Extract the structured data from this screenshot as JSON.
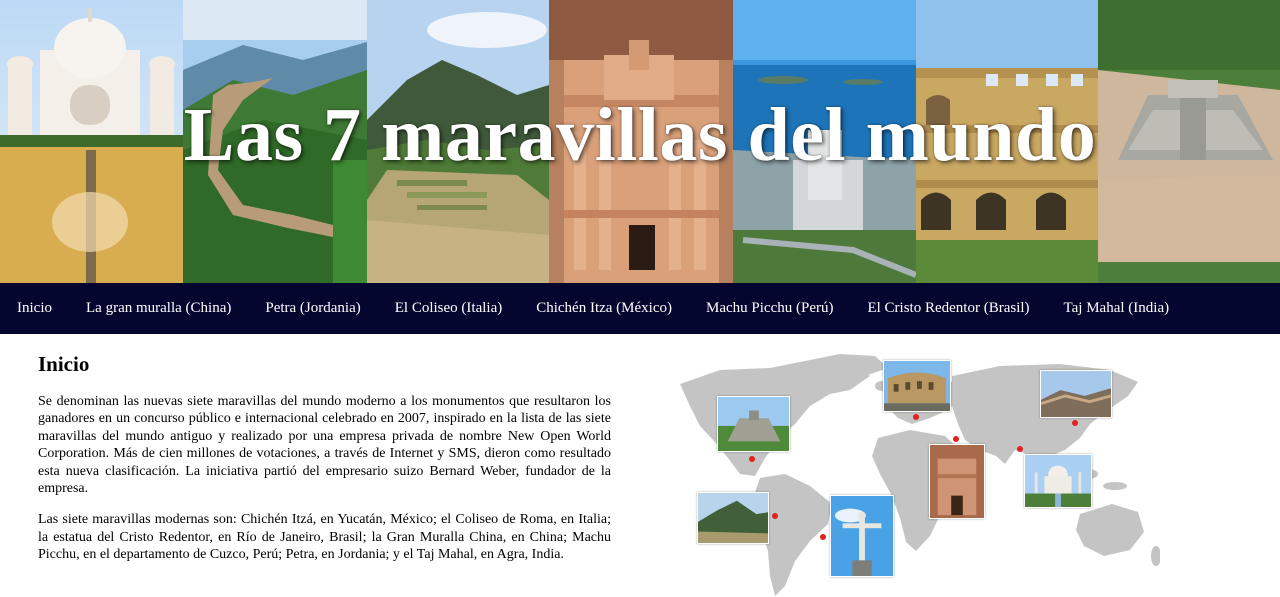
{
  "header": {
    "title": "Las 7 maravillas del mundo",
    "panels": [
      {
        "name": "taj-mahal-photo",
        "sky": "#cfe3f7"
      },
      {
        "name": "great-wall-photo",
        "sky": "#9cc6ec"
      },
      {
        "name": "machu-picchu-photo",
        "sky": "#a8c9ea"
      },
      {
        "name": "petra-photo",
        "sky": "#c99577"
      },
      {
        "name": "cristo-redentor-photo",
        "sky": "#2f8fd9"
      },
      {
        "name": "coliseo-photo",
        "sky": "#8dbbe8"
      },
      {
        "name": "chichen-itza-photo",
        "sky": "#7aa66a"
      }
    ]
  },
  "nav": {
    "items": [
      {
        "label": "Inicio"
      },
      {
        "label": "La gran muralla (China)"
      },
      {
        "label": "Petra (Jordania)"
      },
      {
        "label": "El Coliseo (Italia)"
      },
      {
        "label": "Chichén Itza (México)"
      },
      {
        "label": "Machu Picchu (Perú)"
      },
      {
        "label": "El Cristo Redentor (Brasil)"
      },
      {
        "label": "Taj Mahal (India)"
      }
    ]
  },
  "main": {
    "heading": "Inicio",
    "paragraphs": [
      "Se denominan las nuevas siete maravillas del mundo moderno a los monumentos que resultaron los ganadores en un concurso público e internacional celebrado en 2007, inspirado en la lista de las siete maravillas del mundo antiguo y realizado por una empresa privada de nombre New Open World Corporation. Más de cien millones de votaciones, a través de Internet y SMS, dieron como resultado esta nueva clasificación. La iniciativa partió del empresario suizo Bernard Weber, fundador de la empresa.",
      "Las siete maravillas modernas son: Chichén Itzá, en Yucatán, México; el Coliseo de Roma, en Italia; la estatua del Cristo Redentor, en Río de Janeiro, Brasil; la Gran Muralla China, en China; Machu Picchu, en el departamento de Cuzco, Perú; Petra, en Jordania; y el Taj Mahal, en Agra, India."
    ]
  },
  "map": {
    "land_color": "#c4c4c4",
    "marker_color": "#e2231a",
    "thumbnails": [
      "chichen-itza-thumb",
      "coliseo-thumb",
      "great-wall-thumb",
      "petra-thumb",
      "taj-mahal-thumb",
      "machu-picchu-thumb",
      "cristo-redentor-thumb"
    ]
  }
}
